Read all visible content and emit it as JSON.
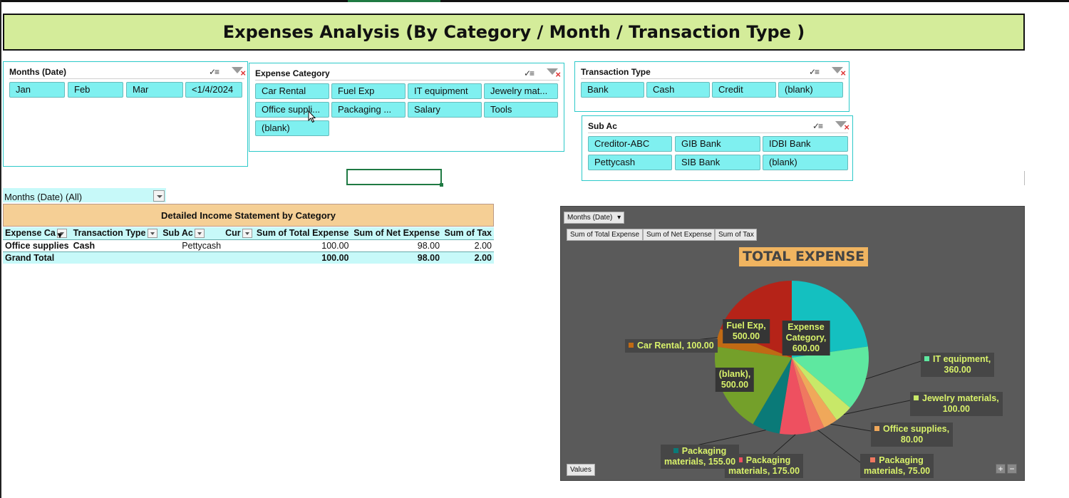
{
  "title": "Expenses Analysis (By Category / Month / Transaction Type )",
  "slicers": {
    "months": {
      "header": "Months (Date)",
      "items": [
        "Jan",
        "Feb",
        "Mar",
        "<1/4/2024"
      ]
    },
    "expense_category": {
      "header": "Expense Category",
      "items": [
        "Car Rental",
        "Fuel Exp",
        "IT equipment",
        "Jewelry mat...",
        "Office suppli...",
        "Packaging ...",
        "Salary",
        "Tools",
        "(blank)"
      ]
    },
    "transaction_type": {
      "header": "Transaction Type",
      "items": [
        "Bank",
        "Cash",
        "Credit",
        "(blank)"
      ]
    },
    "sub_ac": {
      "header": "Sub Ac",
      "items": [
        "Creditor-ABC",
        "GIB Bank",
        "IDBI Bank",
        "Pettycash",
        "SIB Bank",
        "(blank)"
      ]
    }
  },
  "pivot": {
    "filter_label": "Months (Date)  (All)",
    "title": "Detailed Income Statement by Category",
    "headers": [
      "Expense Ca",
      "Transaction Type",
      "Sub Ac",
      "Cur",
      "Sum of Total Expense",
      "Sum of Net Expense",
      "Sum of Tax"
    ],
    "rows": [
      [
        "Office supplies",
        "Cash",
        "Pettycash",
        "",
        "100.00",
        "98.00",
        "2.00"
      ]
    ],
    "grand_total": [
      "Grand Total",
      "",
      "",
      "",
      "100.00",
      "98.00",
      "2.00"
    ]
  },
  "chart": {
    "field_filter": "Months (Date)",
    "value_fields": [
      "Sum of Total Expense",
      "Sum of Net Expense",
      "Sum of Tax"
    ],
    "values_button": "Values",
    "zoom_plus": "+",
    "zoom_minus": "−"
  },
  "chart_data": {
    "type": "pie",
    "title": "TOTAL EXPENSE",
    "slices": [
      {
        "label": "Expense Category",
        "value": 600.0,
        "color": "#14c0c0",
        "text": "Expense\nCategory,\n600.00"
      },
      {
        "label": "IT equipment",
        "value": 360.0,
        "color": "#5ee8a0",
        "text": "IT equipment,\n360.00"
      },
      {
        "label": "Jewelry materials",
        "value": 100.0,
        "color": "#c8e868",
        "text": "Jewelry materials,\n100.00"
      },
      {
        "label": "Office supplies",
        "value": 80.0,
        "color": "#f0a85a",
        "text": "Office supplies,\n80.00"
      },
      {
        "label": "Packaging materials",
        "value": 75.0,
        "color": "#f07860",
        "text": "Packaging\nmaterials,  75.00"
      },
      {
        "label": "Packaging materials",
        "value": 175.0,
        "color": "#ee5060",
        "text": "Packaging\nmaterials,  175.00"
      },
      {
        "label": "Packaging materials",
        "value": 155.0,
        "color": "#0a7a78",
        "text": "Packaging\nmaterials,  155.00"
      },
      {
        "label": "(blank)",
        "value": 500.0,
        "color": "#74a02a",
        "text": "(blank),\n500.00"
      },
      {
        "label": "Car Rental",
        "value": 100.0,
        "color": "#c06a14",
        "text": "Car Rental,  100.00"
      },
      {
        "label": "Fuel Exp",
        "value": 500.0,
        "color": "#b52318",
        "text": "Fuel Exp,\n500.00"
      }
    ]
  }
}
